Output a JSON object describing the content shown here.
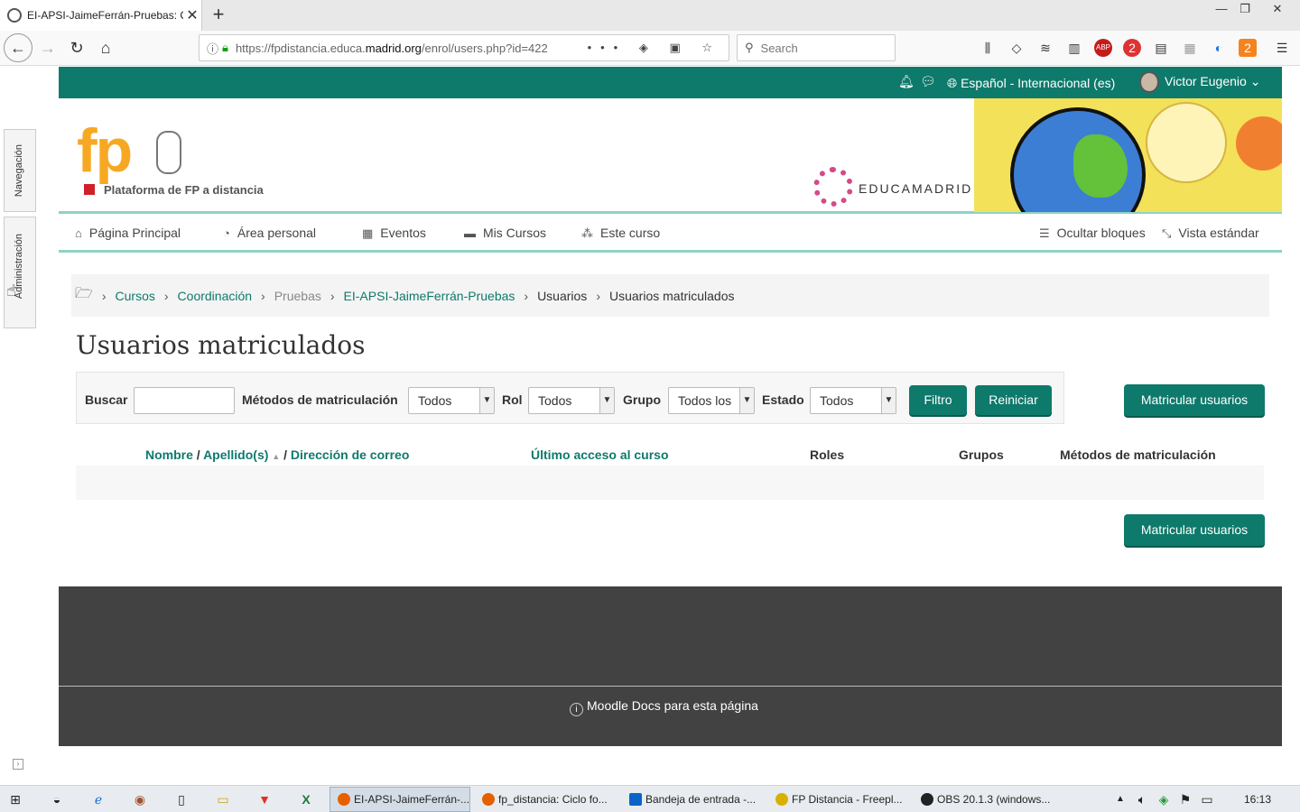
{
  "browser": {
    "tab_title": "EI-APSI-JaimeFerrán-Pruebas: C",
    "tab_close": "✕",
    "new_tab": "+",
    "url_prefix": "https://fpdistancia.educa.",
    "url_domain": "madrid.org",
    "url_path": "/enrol/users.php?id=422",
    "url_icons": "••• ◈ ▣ ☆",
    "search_placeholder": "Search",
    "window_min": "—",
    "window_max": "❐",
    "window_close": "✕",
    "ext_badge_1": "2",
    "ext_badge_2": "2"
  },
  "topbar": {
    "language": "Español - Internacional (es)",
    "user_name": "Victor Eugenio"
  },
  "header": {
    "logo_text": "fp",
    "platform_label": "Plataforma de FP a distancia",
    "educamadrid": "EDUCAMADRID"
  },
  "mainnav": {
    "items": [
      {
        "label": "Página Principal",
        "icon": "home-icon"
      },
      {
        "label": "Área personal",
        "icon": "dashboard-icon"
      },
      {
        "label": "Eventos",
        "icon": "calendar-icon"
      },
      {
        "label": "Mis Cursos",
        "icon": "briefcase-icon"
      },
      {
        "label": "Este curso",
        "icon": "sitemap-icon"
      }
    ],
    "hide_blocks": "Ocultar bloques",
    "standard_view": "Vista estándar"
  },
  "sidebar": {
    "navigation": "Navegación",
    "administration": "Administración"
  },
  "breadcrumb": {
    "items": [
      "Cursos",
      "Coordinación",
      "Pruebas",
      "EI-APSI-JaimeFerrán-Pruebas",
      "Usuarios",
      "Usuarios matriculados"
    ]
  },
  "page": {
    "title": "Usuarios matriculados"
  },
  "filters": {
    "search_label": "Buscar",
    "search_value": "",
    "methods_label": "Métodos de matriculación",
    "methods_value": "Todos",
    "role_label": "Rol",
    "role_value": "Todos",
    "group_label": "Grupo",
    "group_value": "Todos los",
    "status_label": "Estado",
    "status_value": "Todos",
    "filter_button": "Filtro",
    "reset_button": "Reiniciar"
  },
  "actions": {
    "enrol_users": "Matricular usuarios"
  },
  "table": {
    "col_name": "Nombre",
    "col_sep1": "/",
    "col_surname": "Apellido(s)",
    "col_sort": "▲",
    "col_sep2": "/",
    "col_email": "Dirección de correo",
    "col_last_access": "Último acceso al curso",
    "col_roles": "Roles",
    "col_groups": "Grupos",
    "col_methods": "Métodos de matriculación"
  },
  "footer": {
    "docs_link": "Moodle Docs para esta página"
  },
  "taskbar": {
    "tasks": [
      {
        "label": "EI-APSI-JaimeFerrán-...",
        "color": "#e66000"
      },
      {
        "label": "fp_distancia: Ciclo fo...",
        "color": "#e66000"
      },
      {
        "label": "Bandeja de entrada -...",
        "color": "#0a64c8"
      },
      {
        "label": "FP Distancia - Freepl...",
        "color": "#d8b000"
      },
      {
        "label": "OBS 20.1.3 (windows...",
        "color": "#222222"
      }
    ],
    "clock": "16:13"
  },
  "colors": {
    "brand_green": "#0e7a6b",
    "accent_mint": "#8fd1c5",
    "fp_orange": "#f7a823",
    "footer_dark": "#424242"
  }
}
